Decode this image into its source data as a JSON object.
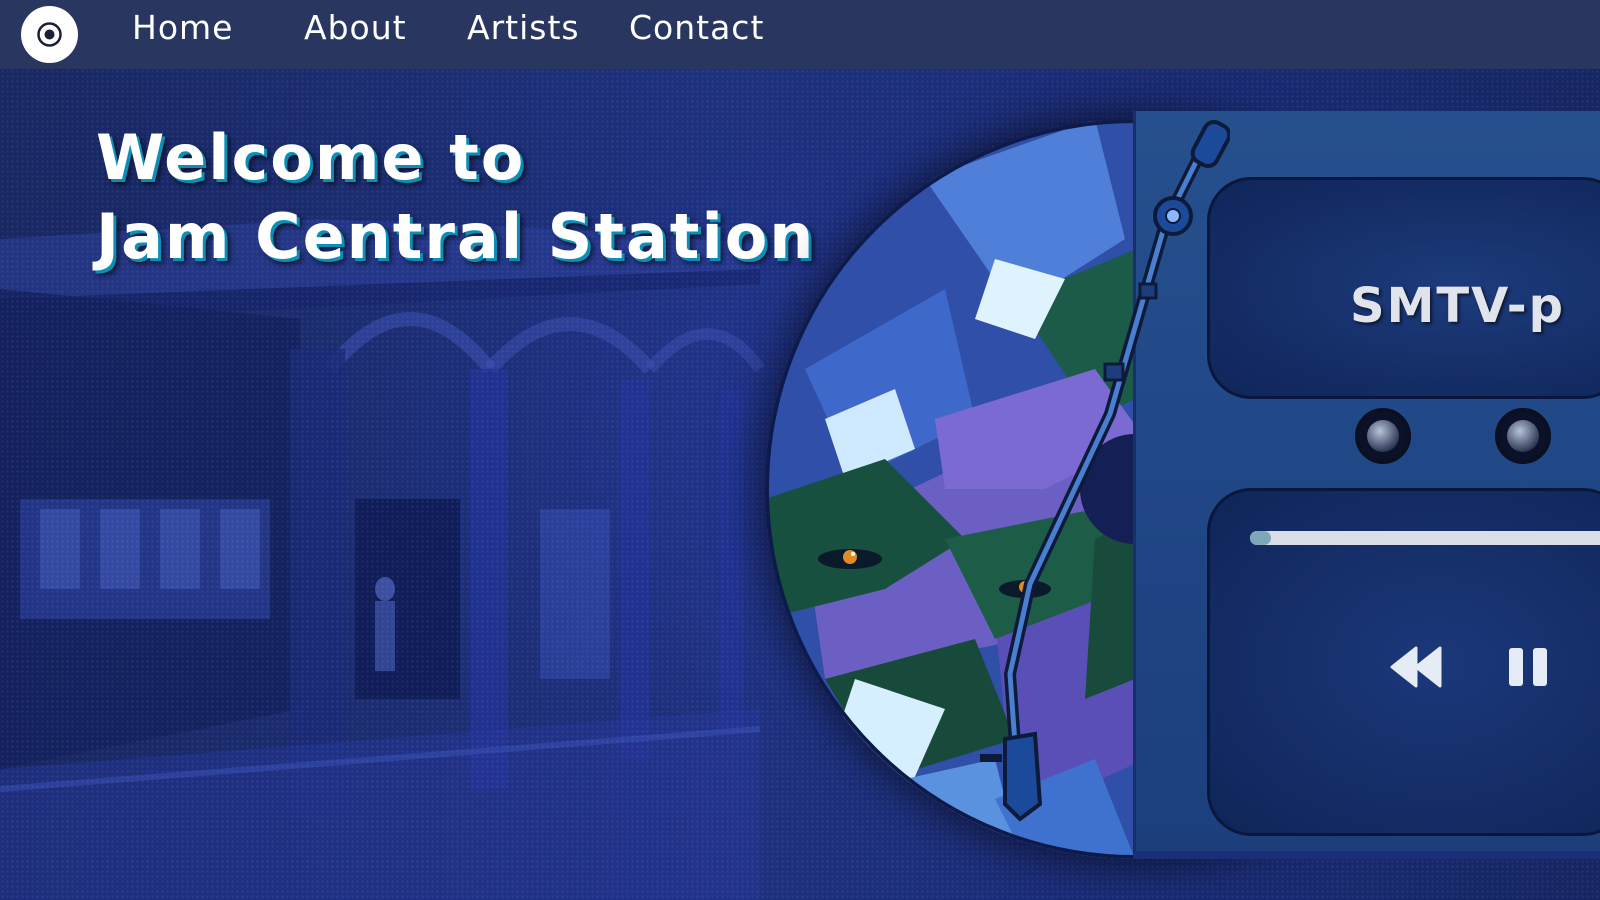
{
  "nav": {
    "logo_icon": "vinyl-record-icon",
    "links": [
      "Home",
      "About",
      "Artists",
      "Contact"
    ]
  },
  "hero": {
    "title_line1": "Welcome to",
    "title_line2": "Jam Central Station"
  },
  "player": {
    "track_title": "SMTV-p",
    "progress": 0.05,
    "controls": [
      "rewind-icon",
      "pause-icon"
    ]
  },
  "colors": {
    "nav_bg": "#293660",
    "hero_bg": "#1f3384",
    "title_shadow": "#0a8fb8",
    "player_panel": "#26508d",
    "screen_bg": "#132b63",
    "progress_track": "#d9dde6",
    "progress_fill": "#7fa7b8"
  }
}
